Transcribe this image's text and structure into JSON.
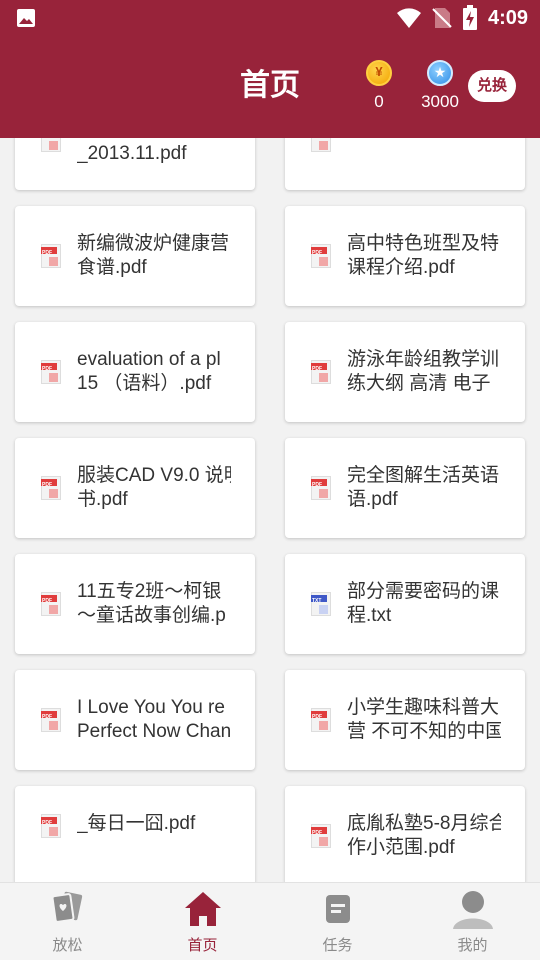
{
  "status_bar": {
    "time": "4:09",
    "icons": [
      "image-icon",
      "wifi-icon",
      "no-sim-icon",
      "battery-charging-icon"
    ]
  },
  "header": {
    "title": "首页",
    "gold_coin": {
      "icon": "gold-coin-icon",
      "symbol": "¥",
      "value": "0"
    },
    "points": {
      "icon": "star-coin-icon",
      "symbol": "★",
      "value": "3000"
    },
    "redeem_label": "兑换",
    "accent_color": "#98233a"
  },
  "files": [
    {
      "name": "_2013.11.pdf",
      "type": "pdf"
    },
    {
      "name": "",
      "type": "pdf"
    },
    {
      "name": "新编微波炉健康营\n食谱.pdf",
      "type": "pdf"
    },
    {
      "name": "高中特色班型及特\n课程介绍.pdf",
      "type": "pdf"
    },
    {
      "name": "evaluation of a pl\n15 （语料）.pdf",
      "type": "pdf"
    },
    {
      "name": "游泳年龄组教学训\n练大纲 高清 电子",
      "type": "pdf"
    },
    {
      "name": "服装CAD V9.0 说明\n书.pdf",
      "type": "pdf"
    },
    {
      "name": "完全图解生活英语\n语.pdf",
      "type": "pdf"
    },
    {
      "name": "11五专2班～柯银\n～童话故事创编.p",
      "type": "pdf"
    },
    {
      "name": "部分需要密码的课\n程.txt",
      "type": "txt"
    },
    {
      "name": "I Love You You re\nPerfect Now Chan",
      "type": "pdf"
    },
    {
      "name": "小学生趣味科普大\n营 不可不知的中国",
      "type": "pdf"
    },
    {
      "name": "_每日一囧.pdf",
      "type": "pdf"
    },
    {
      "name": "底胤私塾5-8月综合\n作小范围.pdf",
      "type": "pdf"
    }
  ],
  "bottom_nav": [
    {
      "label": "放松",
      "icon": "cards-icon",
      "active": false
    },
    {
      "label": "首页",
      "icon": "home-icon",
      "active": true
    },
    {
      "label": "任务",
      "icon": "task-icon",
      "active": false
    },
    {
      "label": "我的",
      "icon": "profile-icon",
      "active": false
    }
  ]
}
